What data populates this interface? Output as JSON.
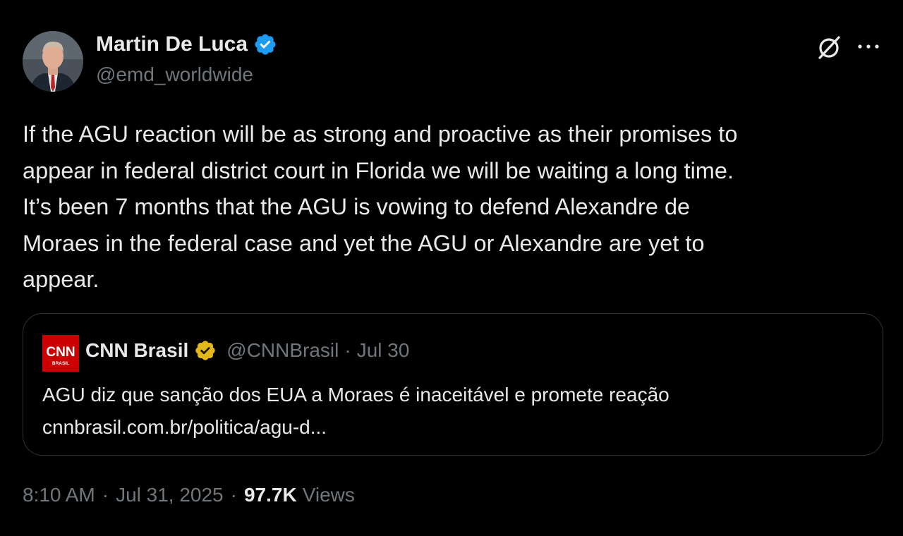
{
  "author": {
    "name": "Martin De Luca",
    "handle": "@emd_worldwide",
    "verified": "blue",
    "avatar_icon": "profile-photo"
  },
  "actions": {
    "grok_icon": "grok-icon",
    "more_icon": "more-icon"
  },
  "tweet": {
    "text": "If the AGU reaction will be as strong and proactive as their promises to\nappear in federal district court in Florida we will be waiting a long time.\nIt’s been 7 months that the AGU is vowing to defend Alexandre de\nMoraes in the federal case and yet the AGU or Alexandre are yet to\nappear."
  },
  "quote": {
    "logo_text": "CNN",
    "logo_subtext": "BRASIL",
    "name": "CNN Brasil",
    "verified": "gold",
    "handle": "@CNNBrasil",
    "separator": "·",
    "date": "Jul 30",
    "text": "AGU diz que sanção dos EUA a Moraes é inaceitável e promete reação\ncnnbrasil.com.br/politica/agu-d..."
  },
  "meta": {
    "time": "8:10 AM",
    "separator": "·",
    "date": "Jul 31, 2025",
    "views_count": "97.7K",
    "views_label": "Views"
  },
  "colors": {
    "background": "#000000",
    "text": "#e7e9ea",
    "muted": "#71767b",
    "border": "#2f3336",
    "verified_blue": "#1d9bf0",
    "verified_gold": "#e2b719",
    "cnn_red": "#cc0000"
  }
}
